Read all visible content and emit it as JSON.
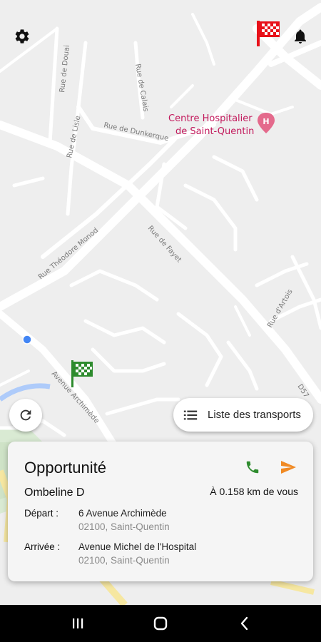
{
  "map": {
    "streets": {
      "rue_de_douai": "Rue de Douai",
      "rue_de_lisle": "Rue de Lisle",
      "rue_de_calais": "Rue de Calais",
      "rue_de_dunkerque": "Rue de Dunkerque",
      "rue_de_fayet": "Rue de Fayet",
      "rue_theodore_monod": "Rue Théodore Monod",
      "rue_dartois": "Rue d'Artois",
      "avenue_archimede": "Avenue Archimède",
      "route_d57": "D57"
    },
    "poi": {
      "line1": "Centre Hospitalier",
      "line2": "de Saint-Quentin",
      "icon_letter": "H"
    }
  },
  "top_bar": {
    "settings_icon": "gear-icon",
    "checkered_flag_icon": "checkered-flag-icon",
    "notification_icon": "bell-icon"
  },
  "refresh_icon": "refresh-icon",
  "transport_list_button": {
    "label": "Liste des transports",
    "icon": "list-icon"
  },
  "opportunity_card": {
    "title": "Opportunité",
    "client_name": "Ombeline D",
    "distance": "À 0.158 km de vous",
    "departure": {
      "label": "Départ :",
      "line1": "6 Avenue Archimède",
      "line2": "02100, Saint-Quentin"
    },
    "arrival": {
      "label": "Arrivée :",
      "line1": "Avenue Michel de l'Hospital",
      "line2": "02100, Saint-Quentin"
    },
    "call_icon": "phone-icon",
    "send_icon": "send-icon"
  },
  "nav_bar": {
    "recent": "recent-apps-icon",
    "home": "home-icon",
    "back": "back-icon"
  },
  "colors": {
    "flag_red": "#e8111a",
    "flag_green": "#2e8b2e",
    "phone_green": "#2e8b2e",
    "send_orange": "#f08a24",
    "hospital_pink": "#e46a8c",
    "location_blue": "#4285f4"
  }
}
